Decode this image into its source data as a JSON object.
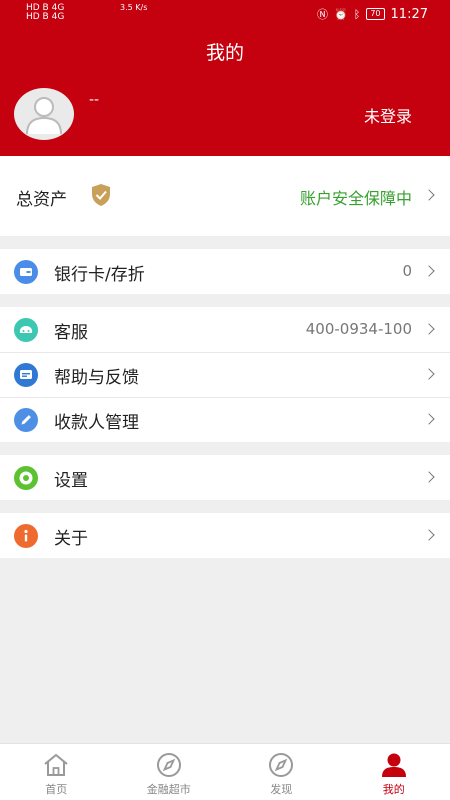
{
  "status_bar": {
    "left_line1": "HD B  4G",
    "left_line2": "HD B  4G",
    "speed": "3.5 K/s",
    "time": "11:27",
    "battery": "70"
  },
  "header": {
    "title": "我的",
    "username": "--",
    "login_status": "未登录"
  },
  "assets": {
    "label": "总资产",
    "secure_text": "账户安全保障中"
  },
  "menu": {
    "bank_card": {
      "label": "银行卡/存折",
      "value": "0"
    },
    "service": {
      "label": "客服",
      "value": "400-0934-100"
    },
    "help": {
      "label": "帮助与反馈"
    },
    "payee": {
      "label": "收款人管理"
    },
    "settings": {
      "label": "设置"
    },
    "about": {
      "label": "关于"
    }
  },
  "tabs": {
    "home": "首页",
    "finance": "金融超市",
    "discover": "发现",
    "mine": "我的"
  },
  "colors": {
    "brand_red": "#c5000f",
    "secure_green": "#37a02f",
    "bank_blue": "#4a8de8",
    "service_teal": "#3cc7b0",
    "help_blue": "#2f79d4",
    "payee_blue": "#4e8fe6",
    "settings_green": "#5cc232",
    "about_orange": "#ef6a2e"
  }
}
